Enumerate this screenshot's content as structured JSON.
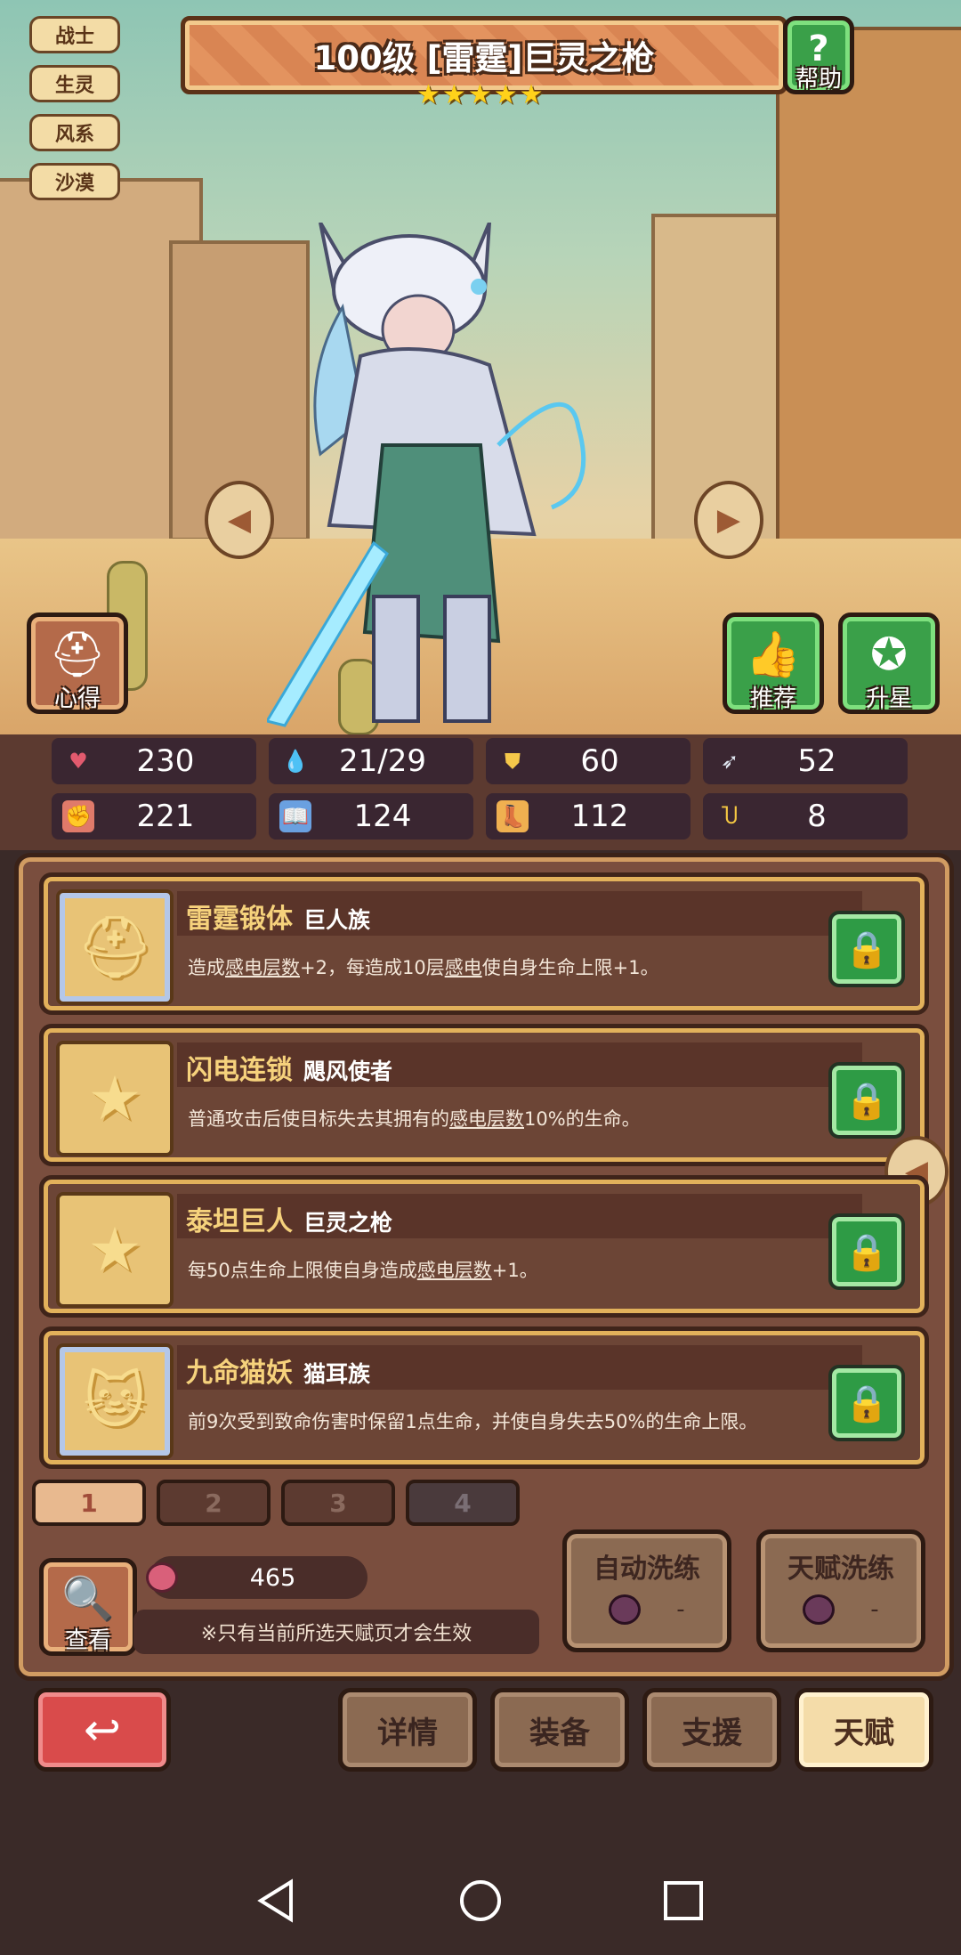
{
  "tags": [
    "战士",
    "生灵",
    "风系",
    "沙漠"
  ],
  "hero": {
    "title": "100级 [雷霆]巨灵之枪",
    "stars": 5
  },
  "buttons": {
    "help": "帮助",
    "experience": "心得",
    "recommend": "推荐",
    "star_up": "升星",
    "view": "查看",
    "back": "↩"
  },
  "stats": [
    {
      "icon": "heart-icon",
      "value": "230",
      "color": "#e25a6e"
    },
    {
      "icon": "mana-drop-icon",
      "value": "21/29",
      "color": "#5aa8e6"
    },
    {
      "icon": "shield-icon",
      "value": "60",
      "color": "#f5c84a"
    },
    {
      "icon": "wing-icon",
      "value": "52",
      "color": "#dfe6f0"
    },
    {
      "icon": "fist-icon",
      "value": "221",
      "color": "#e07a6a"
    },
    {
      "icon": "spellbook-icon",
      "value": "124",
      "color": "#6aa0e0"
    },
    {
      "icon": "boot-icon",
      "value": "112",
      "color": "#f0b050"
    },
    {
      "icon": "horseshoe-icon",
      "value": "8",
      "color": "#f5c842"
    }
  ],
  "talents": [
    {
      "name": "雷霆锻体",
      "race": "巨人族",
      "desc_pre": "造成",
      "desc_u1": "感电层数",
      "desc_mid": "+2，每造成10层",
      "desc_u2": "感电",
      "desc_post": "使自身生命上限+1。",
      "icon": "giant-helmet-icon",
      "frame": "blue"
    },
    {
      "name": "闪电连锁",
      "race": "飓风使者",
      "desc_pre": "普通攻击后使目标失去其拥有的",
      "desc_u1": "感电层数",
      "desc_mid": "10%的生命。",
      "desc_u2": "",
      "desc_post": "",
      "icon": "star-icon",
      "frame": "gold"
    },
    {
      "name": "泰坦巨人",
      "race": "巨灵之枪",
      "desc_pre": "每50点生命上限使自身造成",
      "desc_u1": "感电层数",
      "desc_mid": "+1。",
      "desc_u2": "",
      "desc_post": "",
      "icon": "star-icon",
      "frame": "gold"
    },
    {
      "name": "九命猫妖",
      "race": "猫耳族",
      "desc_pre": "前9次受到致命伤害时保留1点生命，并使自身失去50%的生命上限。",
      "desc_u1": "",
      "desc_mid": "",
      "desc_u2": "",
      "desc_post": "",
      "icon": "cat-head-icon",
      "frame": "blue"
    }
  ],
  "pages": [
    "1",
    "2",
    "3",
    "4"
  ],
  "fruit_count": "465",
  "note": "※只有当前所选天赋页才会生效",
  "refresh": [
    {
      "label": "自动洗练",
      "cost": "-"
    },
    {
      "label": "天赋洗练",
      "cost": "-"
    }
  ],
  "tabs": [
    "详情",
    "装备",
    "支援",
    "天赋"
  ]
}
